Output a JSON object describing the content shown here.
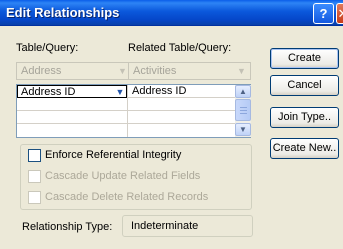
{
  "window": {
    "title": "Edit Relationships",
    "help_glyph": "?",
    "close_glyph": "✕"
  },
  "labels": {
    "table_query": "Table/Query:",
    "related_table_query": "Related Table/Query:",
    "relationship_type": "Relationship Type:"
  },
  "combos": {
    "table": {
      "value": "Address"
    },
    "related_table": {
      "value": "Activities"
    }
  },
  "grid": {
    "rows": [
      {
        "left": "Address ID",
        "right": "Address ID"
      },
      {
        "left": "",
        "right": ""
      },
      {
        "left": "",
        "right": ""
      },
      {
        "left": "",
        "right": ""
      }
    ]
  },
  "options": {
    "enforce_ri": {
      "label": "Enforce Referential Integrity",
      "checked": false,
      "enabled": true
    },
    "cascade_update": {
      "label": "Cascade Update Related Fields",
      "checked": false,
      "enabled": false
    },
    "cascade_delete": {
      "label": "Cascade Delete Related Records",
      "checked": false,
      "enabled": false
    }
  },
  "relationship_type_value": "Indeterminate",
  "buttons": {
    "create": "Create",
    "cancel": "Cancel",
    "join_type": "Join Type..",
    "create_new": "Create New.."
  },
  "colors": {
    "titlebar": "#0B58DC",
    "dialog_bg": "#ECE9D8",
    "disabled_text": "#ACA899"
  }
}
